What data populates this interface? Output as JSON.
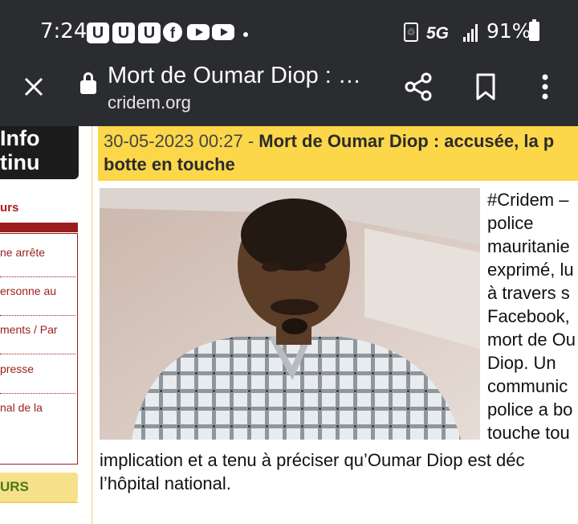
{
  "status_bar": {
    "time": "7:24",
    "notification_icons": [
      "U",
      "U",
      "U"
    ],
    "network": "5G",
    "battery": "91%"
  },
  "url_bar": {
    "title": "Mort de Oumar Diop : …",
    "domain": "cridem.org"
  },
  "sidebar": {
    "logo_line1_a": "Info",
    "logo_line2": "tinu",
    "heading": "urs",
    "items": [
      "ne arrête",
      "ersonne au",
      "ments / Par",
      "presse",
      "nal de la"
    ],
    "yellow_heading": "URS"
  },
  "article": {
    "date": "30-05-2023 00:27",
    "separator": " - ",
    "headline_line1": "Mort de Oumar Diop : accusée, la p",
    "headline_line2": "botte en touche",
    "text_lines_right": [
      "#Cridem –",
      "police",
      "mauritanie",
      "exprimé, lu",
      "à travers s",
      "Facebook,",
      "mort de Ou",
      "Diop. Un",
      "communic",
      "police a bo",
      "touche tou"
    ],
    "text_lines_full": [
      "implication et a tenu à préciser qu’Oumar Diop est déc",
      "l’hôpital national."
    ]
  },
  "colors": {
    "top_bar": "#2b2c30",
    "article_header": "#fcd74a",
    "sidebar_red": "#9c1d1d"
  },
  "icons": [
    "close-icon",
    "lock-icon",
    "share-icon",
    "bookmark-icon",
    "more-vert-icon",
    "facebook-icon",
    "youtube-icon",
    "signal-icon",
    "battery-icon"
  ]
}
